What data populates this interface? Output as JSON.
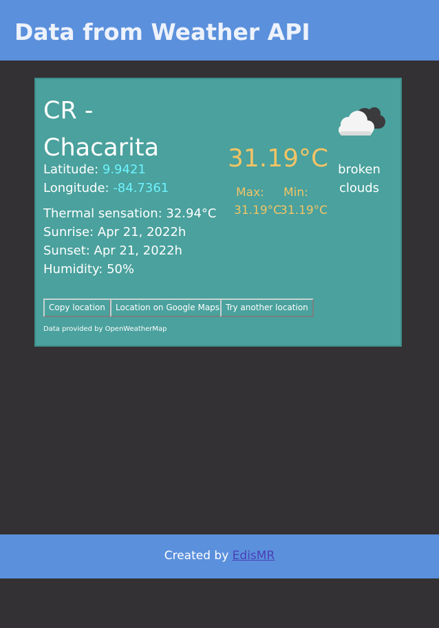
{
  "header": {
    "title": "Data from Weather API"
  },
  "card": {
    "city": "CR - Chacarita",
    "latitude_label": "Latitude: ",
    "latitude_value": "9.9421",
    "longitude_label": "Longitude: ",
    "longitude_value": "-84.7361",
    "thermal": "Thermal sensation: 32.94°C",
    "sunrise": "Sunrise: Apr 21, 2022h",
    "sunset": "Sunset: Apr 21, 2022h",
    "humidity": "Humidity: 50%",
    "temperature": "31.19°C",
    "max_label": "Max:",
    "min_label": "Min:",
    "max_value": "31.19°C",
    "min_value": "31.19°C",
    "weather_icon": "broken-clouds-icon",
    "description": "broken clouds",
    "buttons": {
      "copy": "Copy location",
      "maps": "Location on Google Maps",
      "another": "Try another location"
    },
    "credit": "Data provided by OpenWeatherMap"
  },
  "footer": {
    "prefix": "Created by ",
    "author": "EdisMR"
  },
  "colors": {
    "header_bg": "#5b90dc",
    "page_bg": "#333133",
    "card_bg": "#4aa19d",
    "temp_color": "#f3c466",
    "coord_color": "#6ff2ff"
  }
}
